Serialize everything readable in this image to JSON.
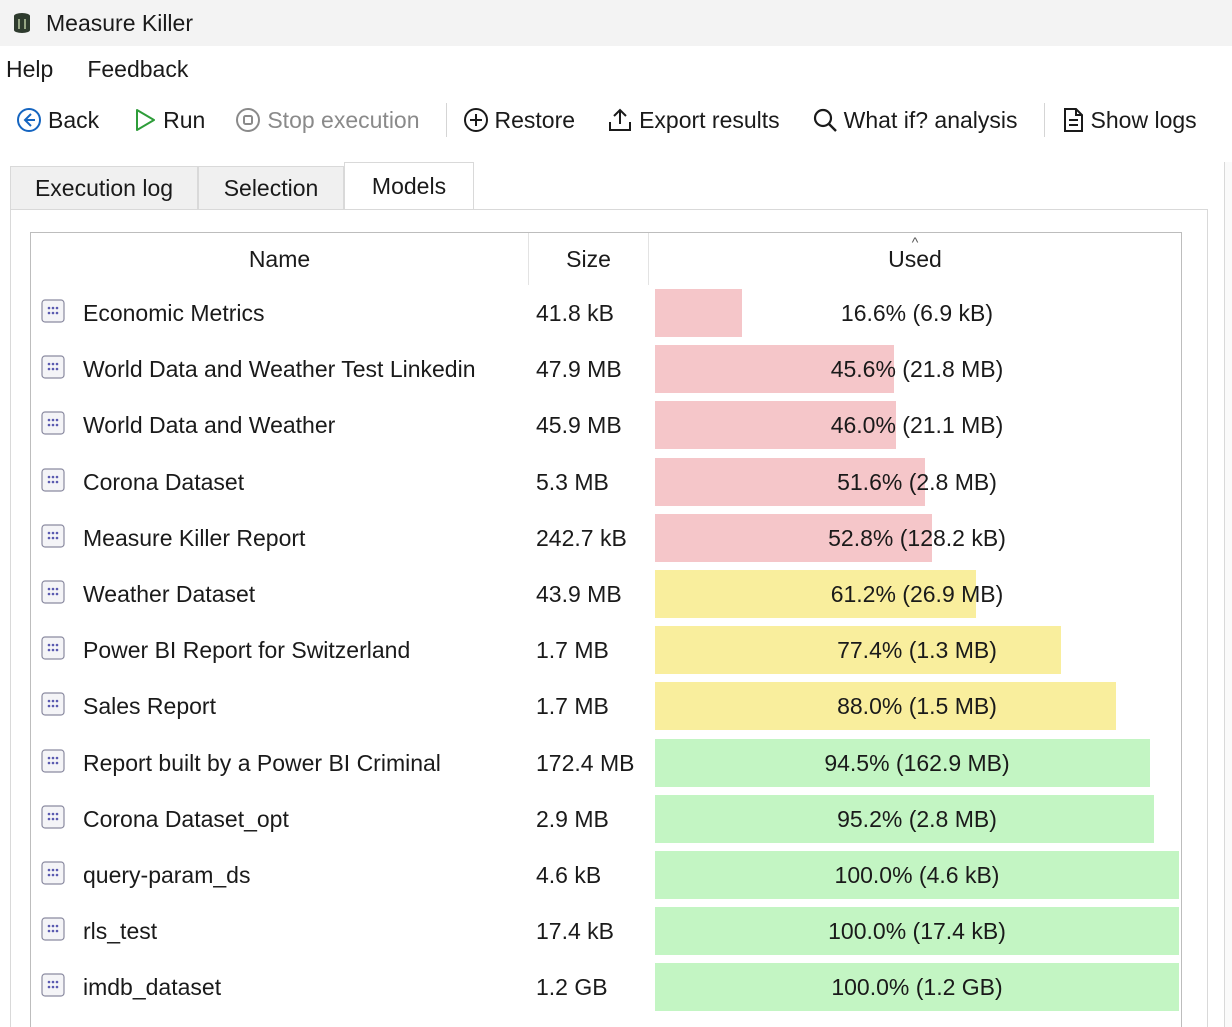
{
  "window": {
    "title": "Measure Killer"
  },
  "menu": [
    "Help",
    "Feedback"
  ],
  "toolbar": {
    "back": "Back",
    "run": "Run",
    "stop": "Stop execution",
    "restore": "Restore",
    "export": "Export results",
    "whatif": "What if? analysis",
    "logs": "Show logs"
  },
  "tabs": [
    "Execution log",
    "Selection",
    "Models"
  ],
  "active_tab": "Models",
  "columns": {
    "name": "Name",
    "size": "Size",
    "used": "Used"
  },
  "sorted_column": "Used",
  "colors": {
    "low": "#f5c6c9",
    "mid": "#f9ee9d",
    "high": "#c3f5c3"
  },
  "models": [
    {
      "name": "Economic Metrics",
      "size": "41.8 kB",
      "used_text": "16.6% (6.9 kB)",
      "used_pct": 16.6,
      "level": "low"
    },
    {
      "name": "World Data and Weather Test Linkedin",
      "size": "47.9 MB",
      "used_text": "45.6% (21.8 MB)",
      "used_pct": 45.6,
      "level": "low"
    },
    {
      "name": "World Data and Weather",
      "size": "45.9 MB",
      "used_text": "46.0% (21.1 MB)",
      "used_pct": 46.0,
      "level": "low"
    },
    {
      "name": "Corona Dataset",
      "size": "5.3 MB",
      "used_text": "51.6% (2.8 MB)",
      "used_pct": 51.6,
      "level": "low"
    },
    {
      "name": "Measure Killer Report",
      "size": "242.7 kB",
      "used_text": "52.8% (128.2 kB)",
      "used_pct": 52.8,
      "level": "low"
    },
    {
      "name": "Weather Dataset",
      "size": "43.9 MB",
      "used_text": "61.2% (26.9 MB)",
      "used_pct": 61.2,
      "level": "mid"
    },
    {
      "name": "Power BI Report for Switzerland",
      "size": "1.7 MB",
      "used_text": "77.4% (1.3 MB)",
      "used_pct": 77.4,
      "level": "mid"
    },
    {
      "name": "Sales Report",
      "size": "1.7 MB",
      "used_text": "88.0% (1.5 MB)",
      "used_pct": 88.0,
      "level": "mid"
    },
    {
      "name": "Report built by a Power BI Criminal",
      "size": "172.4 MB",
      "used_text": "94.5% (162.9 MB)",
      "used_pct": 94.5,
      "level": "high"
    },
    {
      "name": "Corona Dataset_opt",
      "size": "2.9 MB",
      "used_text": "95.2% (2.8 MB)",
      "used_pct": 95.2,
      "level": "high"
    },
    {
      "name": "query-param_ds",
      "size": "4.6 kB",
      "used_text": "100.0% (4.6 kB)",
      "used_pct": 100.0,
      "level": "high"
    },
    {
      "name": "rls_test",
      "size": "17.4 kB",
      "used_text": "100.0% (17.4 kB)",
      "used_pct": 100.0,
      "level": "high"
    },
    {
      "name": "imdb_dataset",
      "size": "1.2 GB",
      "used_text": "100.0% (1.2 GB)",
      "used_pct": 100.0,
      "level": "high"
    }
  ]
}
